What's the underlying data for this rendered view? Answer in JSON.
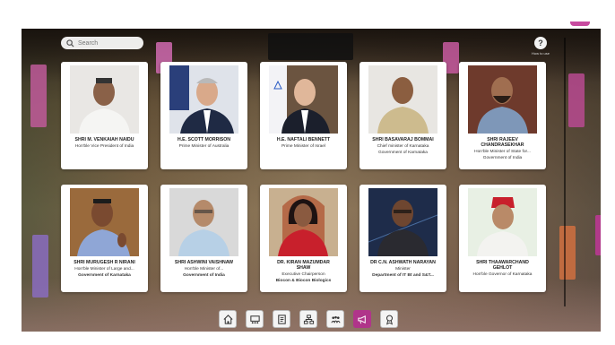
{
  "search": {
    "placeholder": "Search"
  },
  "help": {
    "symbol": "?",
    "label": "How to use"
  },
  "cards": [
    {
      "name": "SHRI M. VENKAIAH NAIDU",
      "lines": [
        "Hon'ble Vice President of India"
      ],
      "bold_last": false
    },
    {
      "name": "H.E. SCOTT MORRISON",
      "lines": [
        "Prime Minister of Australia"
      ],
      "bold_last": false
    },
    {
      "name": "H.E. NAFTALI BENNETT",
      "lines": [
        "Prime Minister of Israel"
      ],
      "bold_last": false
    },
    {
      "name": "SHRI BASAVARAJ BOMMAI",
      "lines": [
        "Chief minister of Karnataka",
        "Government of Karnataka"
      ],
      "bold_last": false
    },
    {
      "name_lines": [
        "SHRI RAJEEV",
        "CHANDRASEKHAR"
      ],
      "lines": [
        "Hon'ble Minister of State for...",
        "Government of India"
      ],
      "bold_last": false
    },
    {
      "name": "SHRI MURUGESH R NIRANI",
      "lines": [
        "Hon'ble Minister of Large and...",
        "Government of Karnataka"
      ],
      "bold_last": true
    },
    {
      "name": "SHRI ASHWINI VAISHNAW",
      "lines": [
        "Hon'ble Minister of...",
        "Government of India"
      ],
      "bold_last": true
    },
    {
      "name_lines": [
        "DR. KIRAN MAZUMDAR",
        "SHAW"
      ],
      "lines": [
        "Executive Chairperson",
        "Biocon & Biocon Biologics"
      ],
      "bold_last": true
    },
    {
      "name": "DR C.N. ASHWATH NARAYAN",
      "lines": [
        "Minister",
        "Department of IT Bt and S&T..."
      ],
      "bold_last": true
    },
    {
      "name_lines": [
        "SHRI THAAWARCHAND",
        "GEHLOT"
      ],
      "lines": [
        "Hon'ble Governor of Karnataka"
      ],
      "bold_last": false
    }
  ],
  "toolbar": {
    "buttons": [
      {
        "name": "home-icon",
        "active": false
      },
      {
        "name": "theatre-icon",
        "active": false
      },
      {
        "name": "agenda-icon",
        "active": false
      },
      {
        "name": "network-icon",
        "active": false
      },
      {
        "name": "people-icon",
        "active": false
      },
      {
        "name": "megaphone-icon",
        "active": true
      },
      {
        "name": "award-icon",
        "active": false
      }
    ]
  },
  "colors": {
    "accent": "#b0358a",
    "card_bg": "#ffffff"
  }
}
